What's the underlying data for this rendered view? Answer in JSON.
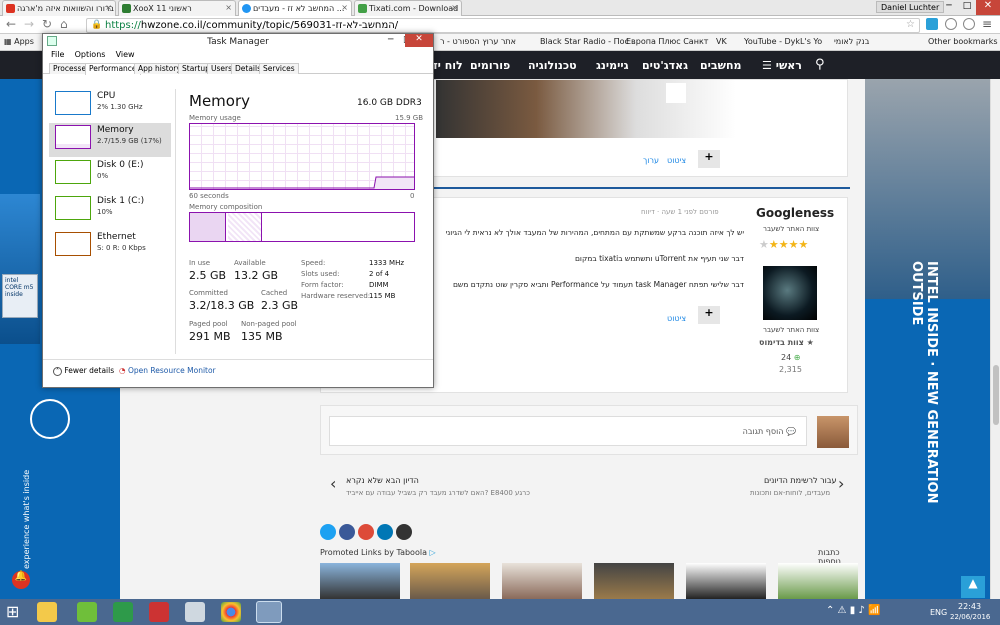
{
  "browser": {
    "tabs": [
      {
        "label": "ברורו והשוואות איזה מ'ארגה",
        "color": "#d32"
      },
      {
        "label": "ראשוני מאוד - מרתק 11 Ne",
        "color": "#4caf50"
      },
      {
        "label": "XooX 11 ראשוני",
        "color": "#2e7d32"
      },
      {
        "label": "המחשב לא זז - מעבדים ...",
        "color": "#2196f3"
      },
      {
        "label": "Tixati.com - Download",
        "color": "#43a047"
      }
    ],
    "user": "Daniel Luchter",
    "url_scheme": "https://",
    "url_rest": "hwzone.co.il/community/topic/569031-המחשב-לא-זז/",
    "bookmarks": [
      "Apps",
      "אתר ערוץ הספורט - ר",
      "Black Star Radio - Пос",
      "Европа Плюс Санкт",
      "VK",
      "YouTube - DykL's Yo",
      "בנק לאומי",
      "Other bookmarks"
    ]
  },
  "site": {
    "nav": [
      "ראשי",
      "מחשבים",
      "גאדג'טים",
      "גיימינג",
      "טכנולוגיה",
      "פורומים",
      "לוח יד שנייה"
    ],
    "post_meta": "פורסם לפני 1 שעה · דיווח",
    "author": "Googleness",
    "author_rank": "צוות האתר לשעבר",
    "author_rank2": "צוות האתר לשעבר",
    "author_team": "צוות בדימוס",
    "author_rep": "24",
    "author_posts": "2,315",
    "post_lines": [
      "יש לך איזה תוכנה ברקע שמשתקת עם המתחים, המהירות של המעבד אולך לא נראית לי הגיוני",
      "דבר שני תעיף את uTorrent ותשתמש בtixati במקום",
      "דבר שלישי תפתח task Manager תעמוד על Performance ותביא סקרין שוט נתקדם משם"
    ],
    "quote_btn": "ציטוט",
    "edit_btn": "ערוך",
    "plus_btn": "+",
    "reply_placeholder": "הוסף תגובה",
    "prev_title": "הדיון הבא שלא נקרא",
    "prev_sub": "האם לשדרג מעבד רק בשביל עבודה עם אייביד? E8400 כרגע",
    "next_title": "עבור לרשימת הדיונים",
    "next_sub": "מעבדים, לוחות-אם ותכונות",
    "promoted": "Promoted Links by Taboola",
    "promoted_right": "כתבות נוספות",
    "ad_left_text": "experience what's inside",
    "ad_right_text": "INTEL INSIDE · NEW GENERATION OUTSIDE",
    "ad_badge": "intel CORE m5 inside"
  },
  "taskmgr": {
    "title": "Task Manager",
    "menu": [
      "File",
      "Options",
      "View"
    ],
    "tabs": [
      "Processes",
      "Performance",
      "App history",
      "Startup",
      "Users",
      "Details",
      "Services"
    ],
    "items": [
      {
        "name": "CPU",
        "sub": "2% 1.30 GHz",
        "color": "#1979ca"
      },
      {
        "name": "Memory",
        "sub": "2.7/15.9 GB (17%)",
        "color": "#8b12ae"
      },
      {
        "name": "Disk 0 (E:)",
        "sub": "0%",
        "color": "#4da60c"
      },
      {
        "name": "Disk 1 (C:)",
        "sub": "10%",
        "color": "#4da60c"
      },
      {
        "name": "Ethernet",
        "sub": "S: 0 R: 0 Kbps",
        "color": "#a74f01"
      }
    ],
    "heading": "Memory",
    "capacity": "16.0 GB DDR3",
    "usage_label": "Memory usage",
    "usage_max": "15.9 GB",
    "seconds": "60 seconds",
    "zero": "0",
    "composition": "Memory composition",
    "stats": {
      "in_use_l": "In use",
      "in_use": "2.5 GB",
      "available_l": "Available",
      "available": "13.2 GB",
      "committed_l": "Committed",
      "committed": "3.2/18.3 GB",
      "cached_l": "Cached",
      "cached": "2.3 GB",
      "paged_l": "Paged pool",
      "paged": "291 MB",
      "nonpaged_l": "Non-paged pool",
      "nonpaged": "135 MB",
      "speed_l": "Speed:",
      "speed": "1333 MHz",
      "slots_l": "Slots used:",
      "slots": "2 of 4",
      "form_l": "Form factor:",
      "form": "DIMM",
      "hwres_l": "Hardware reserved:",
      "hwres": "115 MB"
    },
    "fewer": "Fewer details",
    "resmon": "Open Resource Monitor"
  },
  "taskbar": {
    "lang": "ENG",
    "time": "22:43",
    "date": "22/06/2016"
  }
}
